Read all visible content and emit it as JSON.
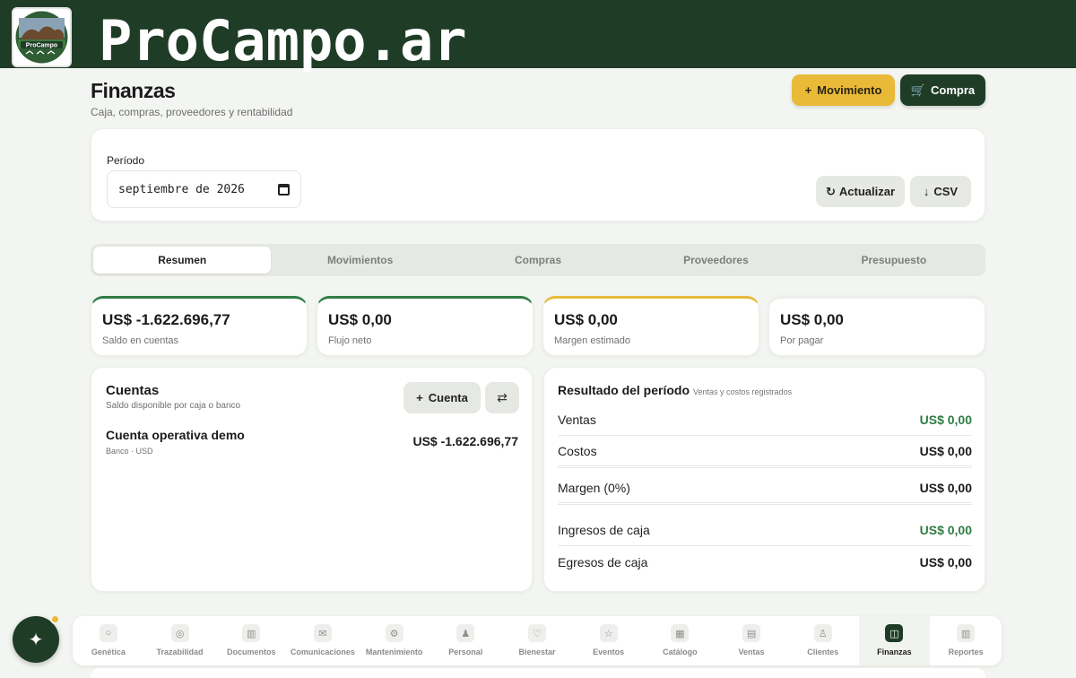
{
  "brand": {
    "title": "ProCampo.ar",
    "logo_text": "ProCampo.ar"
  },
  "header": {
    "title": "Finanzas",
    "subtitle": "Caja, compras, proveedores y rentabilidad",
    "movimiento_label": "Movimiento",
    "compra_label": "Compra"
  },
  "period": {
    "label": "Período",
    "value": "septiembre de 2026",
    "actualizar_label": "Actualizar",
    "csv_label": "CSV"
  },
  "tabs": [
    {
      "label": "Resumen",
      "active": true
    },
    {
      "label": "Movimientos"
    },
    {
      "label": "Compras"
    },
    {
      "label": "Proveedores"
    },
    {
      "label": "Presupuesto"
    }
  ],
  "kpis": [
    {
      "value": "US$ -1.622.696,77",
      "label": "Saldo en cuentas",
      "accent": "#2f7d44"
    },
    {
      "value": "US$ 0,00",
      "label": "Flujo neto",
      "accent": "#2f7d44"
    },
    {
      "value": "US$ 0,00",
      "label": "Margen estimado",
      "accent": "#e9b938"
    },
    {
      "value": "US$ 0,00",
      "label": "Por pagar",
      "accent": "#eceeea"
    }
  ],
  "cuentas": {
    "title": "Cuentas",
    "subtitle": "Saldo disponible por caja o banco",
    "add_label": "Cuenta",
    "accounts": [
      {
        "name": "Cuenta operativa demo",
        "type": "Banco · USD",
        "balance": "US$ -1.622.696,77"
      }
    ]
  },
  "resultado": {
    "title": "Resultado del período",
    "subtitle": "Ventas y costos registrados",
    "rows": [
      {
        "label": "Ventas",
        "value": "US$ 0,00",
        "color": "green"
      },
      {
        "label": "Costos",
        "value": "US$ 0,00"
      },
      {
        "label": "Margen (0%)",
        "value": "US$ 0,00"
      },
      {
        "label": "Ingresos de caja",
        "value": "US$ 0,00",
        "color": "green"
      },
      {
        "label": "Egresos de caja",
        "value": "US$ 0,00"
      }
    ]
  },
  "bottom_nav": [
    {
      "label": "Genética",
      "icon": "dna-icon",
      "glyph": "○"
    },
    {
      "label": "Trazabilidad",
      "icon": "target-icon",
      "glyph": "◎"
    },
    {
      "label": "Documentos",
      "icon": "document-icon",
      "glyph": "▥"
    },
    {
      "label": "Comunicaciones",
      "icon": "mail-icon",
      "glyph": "✉"
    },
    {
      "label": "Mantenimiento",
      "icon": "gear-icon",
      "glyph": "⚙"
    },
    {
      "label": "Personal",
      "icon": "person-icon",
      "glyph": "♟"
    },
    {
      "label": "Bienestar",
      "icon": "heart-icon",
      "glyph": "♡"
    },
    {
      "label": "Eventos",
      "icon": "star-icon",
      "glyph": "☆"
    },
    {
      "label": "Catálogo",
      "icon": "catalog-icon",
      "glyph": "▦"
    },
    {
      "label": "Ventas",
      "icon": "sales-icon",
      "glyph": "▤"
    },
    {
      "label": "Clientes",
      "icon": "clients-icon",
      "glyph": "♙"
    },
    {
      "label": "Finanzas",
      "icon": "finance-icon",
      "glyph": "◫",
      "active": true
    },
    {
      "label": "Reportes",
      "icon": "reports-icon",
      "glyph": "▥"
    }
  ],
  "colors": {
    "brand_green": "#1f3d26",
    "accent_gold": "#e9b938",
    "positive_green": "#2f7d44"
  }
}
